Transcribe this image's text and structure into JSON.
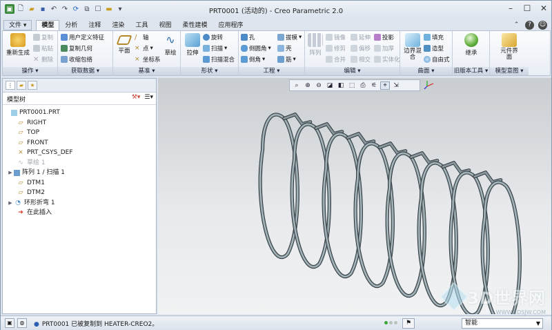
{
  "window": {
    "title": "PRT0001 (活动的) - Creo Parametric 2.0"
  },
  "tabs": [
    "文件 ▾",
    "模型",
    "分析",
    "注释",
    "渲染",
    "工具",
    "视图",
    "柔性建模",
    "应用程序"
  ],
  "ribbon": {
    "groups": [
      {
        "label": "操作 ▾"
      },
      {
        "label": "获取数据 ▾"
      },
      {
        "label": "基准 ▾"
      },
      {
        "label": "形状 ▾"
      },
      {
        "label": "工程 ▾"
      },
      {
        "label": "编辑 ▾"
      },
      {
        "label": "曲面 ▾"
      },
      {
        "label": "旧版本工具 ▾"
      },
      {
        "label": "模型意图 ▾"
      }
    ],
    "op": {
      "regen": "重新生成",
      "copy": "复制",
      "paste": "粘贴",
      "delete": "删除"
    },
    "get": {
      "udf": "用户定义特征",
      "copygeom": "复制几何",
      "shrink": "收缩包络"
    },
    "datum": {
      "plane": "平面",
      "axis": "轴",
      "point": "点",
      "csys": "坐标系",
      "sketch": "草绘"
    },
    "shape": {
      "extrude": "拉伸",
      "revolve": "旋转",
      "sweep": "扫描",
      "sweepblend": "扫描混合"
    },
    "eng": {
      "hole": "孔",
      "round": "倒圆角",
      "chamfer": "倒角",
      "draft": "拔模",
      "shell": "壳",
      "rib": "筋"
    },
    "edit": {
      "pattern": "阵列",
      "mirror": "镜像",
      "trim": "修剪",
      "merge": "合并",
      "extend": "延伸",
      "offset": "偏移",
      "intersect": "相交",
      "project": "投影",
      "thicken": "加厚",
      "solidify": "实体化"
    },
    "surface": {
      "boundary": "边界混合",
      "fill": "填充",
      "style": "造型",
      "freeform": "自由式"
    },
    "legacy": {
      "inherit": "继承"
    },
    "intent": {
      "component": "元件界面"
    }
  },
  "model_tree": {
    "header": "模型树",
    "items": [
      {
        "label": "PRT0001.PRT"
      },
      {
        "label": "RIGHT"
      },
      {
        "label": "TOP"
      },
      {
        "label": "FRONT"
      },
      {
        "label": "PRT_CSYS_DEF"
      },
      {
        "label": "草绘 1"
      },
      {
        "label": "阵列 1 / 扫描 1"
      },
      {
        "label": "DTM1"
      },
      {
        "label": "DTM2"
      },
      {
        "label": "环形折弯 1"
      },
      {
        "label": "在此插入"
      }
    ]
  },
  "watermark": {
    "text": "3D世界网",
    "sub": "WWW.3DSJW.COM"
  },
  "status": {
    "message": "PRT0001 已被复制到 HEATER-CREO2。",
    "filter": "智能"
  }
}
